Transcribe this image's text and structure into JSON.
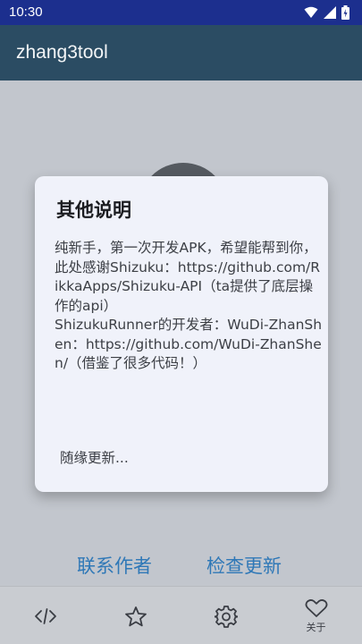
{
  "status_bar": {
    "time": "10:30"
  },
  "app_bar": {
    "title": "zhang3tool"
  },
  "dialog": {
    "title": "其他说明",
    "body": "纯新手，第一次开发APK，希望能帮到你，此处感谢Shizuku：https://github.com/RikkaApps/Shizuku-API（ta提供了底层操作的api）\n ShizukuRunner的开发者：WuDi-ZhanShen：https://github.com/WuDi-ZhanShen/（借鉴了很多代码！）",
    "note": "随缘更新..."
  },
  "links": {
    "contact": "联系作者",
    "check_update": "检查更新"
  },
  "bottom_nav": {
    "items": [
      {
        "icon": "code-icon",
        "label": ""
      },
      {
        "icon": "star-icon",
        "label": ""
      },
      {
        "icon": "settings-icon",
        "label": ""
      },
      {
        "icon": "heart-icon",
        "label": "关于"
      }
    ],
    "selected": "关于"
  }
}
